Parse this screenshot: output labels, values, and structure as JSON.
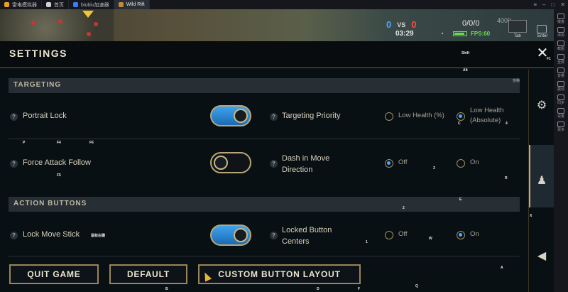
{
  "emulator": {
    "tabs": [
      {
        "label": "雷电模拟器",
        "color": "#f0a020"
      },
      {
        "label": "首页",
        "color": "#d0d0d0"
      },
      {
        "label": "biubiu加速器",
        "color": "#3a7bff"
      },
      {
        "label": "Wild Rift",
        "color": "#c08a3a"
      }
    ],
    "right_toolbar": [
      "键盘",
      "添加",
      "截图",
      "全屏",
      "音量",
      "震动",
      "同步",
      "设置",
      "更多"
    ],
    "right_toolbar_keys": [
      "F1",
      "F2",
      "F3"
    ]
  },
  "hud": {
    "score_blue": "0",
    "vs": "VS",
    "score_red": "0",
    "timer": "03:29",
    "kda": "0/0/0",
    "gold": "4000",
    "fps": "FPS:60",
    "tab_key": "Tab",
    "enter_key": "Enter"
  },
  "settings": {
    "title": "SETTINGS",
    "close_hint": "F1",
    "sections": {
      "targeting": "TARGETING",
      "action_buttons": "ACTION BUTTONS"
    },
    "help_glyph": "?",
    "options": {
      "portrait_lock": {
        "label": "Portrait Lock",
        "state": "on"
      },
      "force_attack_follow": {
        "label": "Force Attack Follow",
        "state": "off"
      },
      "lock_move_stick": {
        "label": "Lock Move Stick",
        "state": "on"
      },
      "targeting_priority": {
        "label": "Targeting Priority",
        "choices": [
          "Low Health (%)",
          "Low Health (Absolute)"
        ],
        "selected": 1
      },
      "dash_move_direction": {
        "label": "Dash in Move Direction",
        "choices": [
          "Off",
          "On"
        ],
        "selected": 0
      },
      "locked_button_centers": {
        "label": "Locked Button Centers",
        "choices": [
          "Off",
          "On"
        ],
        "selected": 1
      }
    },
    "buttons": {
      "quit": "QUIT GAME",
      "default": "DEFAULT",
      "custom_layout": "CUSTOM BUTTON LAYOUT"
    },
    "key_hints": {
      "shift": "Shift",
      "alt": "Alt",
      "space": "空格",
      "p": "P",
      "f4": "F4",
      "f6": "F6",
      "f5": "F5",
      "c": "C",
      "four": "4",
      "three": "3",
      "r": "R",
      "e": "E",
      "two": "2",
      "x": "X",
      "w": "W",
      "one": "1",
      "a": "A",
      "q": "Q",
      "d": "D",
      "f": "F",
      "b": "B",
      "skill_lock": "鼠标右键"
    }
  }
}
